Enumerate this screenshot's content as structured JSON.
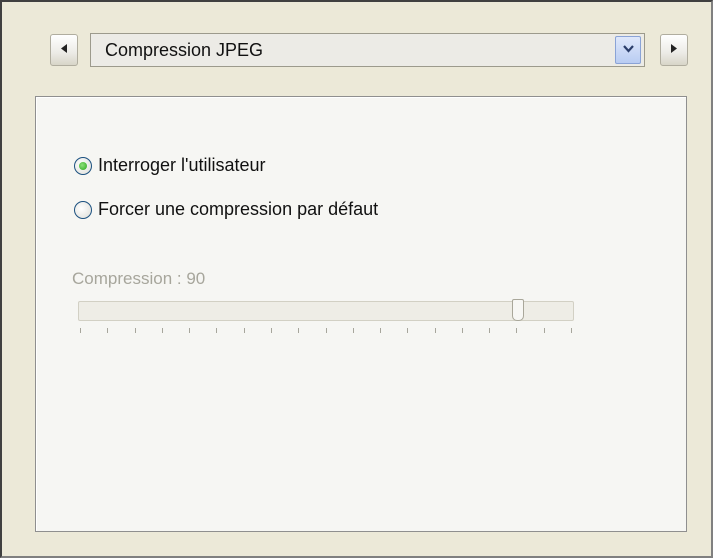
{
  "toolbar": {
    "prev_icon": "◀",
    "next_icon": "▶",
    "dropdown_icon": "chevron-down"
  },
  "combo": {
    "selected": "Compression JPEG"
  },
  "options": [
    {
      "label": "Interroger l'utilisateur",
      "checked": true
    },
    {
      "label": "Forcer une compression par défaut",
      "checked": false
    }
  ],
  "compression": {
    "label": "Compression : 90",
    "value": 90,
    "min": 0,
    "max": 100,
    "enabled": false,
    "tick_count": 19
  }
}
